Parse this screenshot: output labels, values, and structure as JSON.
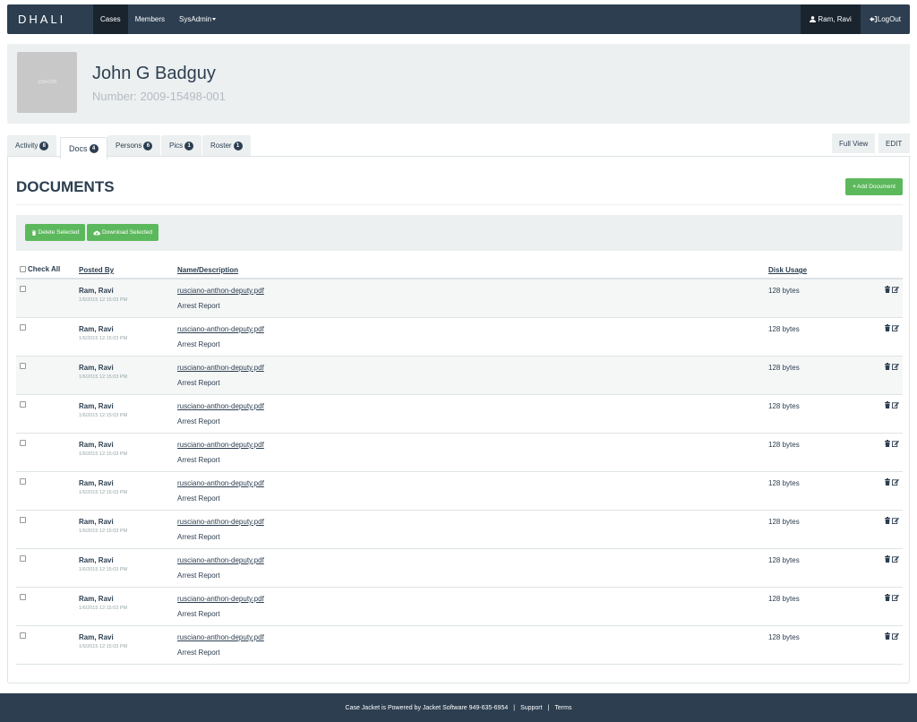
{
  "nav": {
    "brand": "DHALI",
    "items": [
      {
        "label": "Cases"
      },
      {
        "label": "Members"
      },
      {
        "label": "SysAdmin"
      }
    ],
    "user": "Ram, Ravi",
    "logout": "LogOut"
  },
  "header": {
    "avatar_placeholder": "150×150",
    "name": "John G Badguy",
    "number": "Number: 2009-15498-001"
  },
  "tabs": [
    {
      "label": "Activity",
      "count": "8"
    },
    {
      "label": "Docs",
      "count": "4"
    },
    {
      "label": "Persons",
      "count": "6"
    },
    {
      "label": "Pics",
      "count": "1"
    },
    {
      "label": "Roster",
      "count": "1"
    }
  ],
  "right_tabs": {
    "full_view": "Full View",
    "edit": "EDIT"
  },
  "documents": {
    "title": "DOCUMENTS",
    "add_button": "Add Document",
    "delete_selected": "Delete Selected",
    "download_selected": "Download Selected",
    "columns": {
      "check_all": "Check All",
      "posted_by": "Posted By",
      "name": "Name/Description",
      "disk_usage": "Disk Usage"
    },
    "rows": [
      {
        "poster": "Ram, Ravi",
        "date": "1/6/2015 12:15:03 PM",
        "file": "rusciano-anthon-deputy.pdf",
        "desc": "Arrest Report",
        "size": "128 bytes"
      },
      {
        "poster": "Ram, Ravi",
        "date": "1/6/2015 12:15:03 PM",
        "file": "rusciano-anthon-deputy.pdf",
        "desc": "Arrest Report",
        "size": "128 bytes"
      },
      {
        "poster": "Ram, Ravi",
        "date": "1/6/2015 12:15:03 PM",
        "file": "rusciano-anthon-deputy.pdf",
        "desc": "Arrest Report",
        "size": "128 bytes"
      },
      {
        "poster": "Ram, Ravi",
        "date": "1/6/2015 12:15:03 PM",
        "file": "rusciano-anthon-deputy.pdf",
        "desc": "Arrest Report",
        "size": "128 bytes"
      },
      {
        "poster": "Ram, Ravi",
        "date": "1/6/2015 12:15:03 PM",
        "file": "rusciano-anthon-deputy.pdf",
        "desc": "Arrest Report",
        "size": "128 bytes"
      },
      {
        "poster": "Ram, Ravi",
        "date": "1/6/2015 12:15:03 PM",
        "file": "rusciano-anthon-deputy.pdf",
        "desc": "Arrest Report",
        "size": "128 bytes"
      },
      {
        "poster": "Ram, Ravi",
        "date": "1/6/2015 12:15:03 PM",
        "file": "rusciano-anthon-deputy.pdf",
        "desc": "Arrest Report",
        "size": "128 bytes"
      },
      {
        "poster": "Ram, Ravi",
        "date": "1/6/2015 12:15:03 PM",
        "file": "rusciano-anthon-deputy.pdf",
        "desc": "Arrest Report",
        "size": "128 bytes"
      },
      {
        "poster": "Ram, Ravi",
        "date": "1/6/2015 12:15:03 PM",
        "file": "rusciano-anthon-deputy.pdf",
        "desc": "Arrest Report",
        "size": "128 bytes"
      },
      {
        "poster": "Ram, Ravi",
        "date": "1/6/2015 12:15:03 PM",
        "file": "rusciano-anthon-deputy.pdf",
        "desc": "Arrest Report",
        "size": "128 bytes"
      }
    ]
  },
  "footer": {
    "text": "Case Jacket is Powered by Jacket Software 949-635-6954",
    "support": "Support",
    "terms": "Terms"
  },
  "colors": {
    "navy": "#2c3e50",
    "light_gray": "#ecf0f1",
    "green": "#5cb85c"
  }
}
